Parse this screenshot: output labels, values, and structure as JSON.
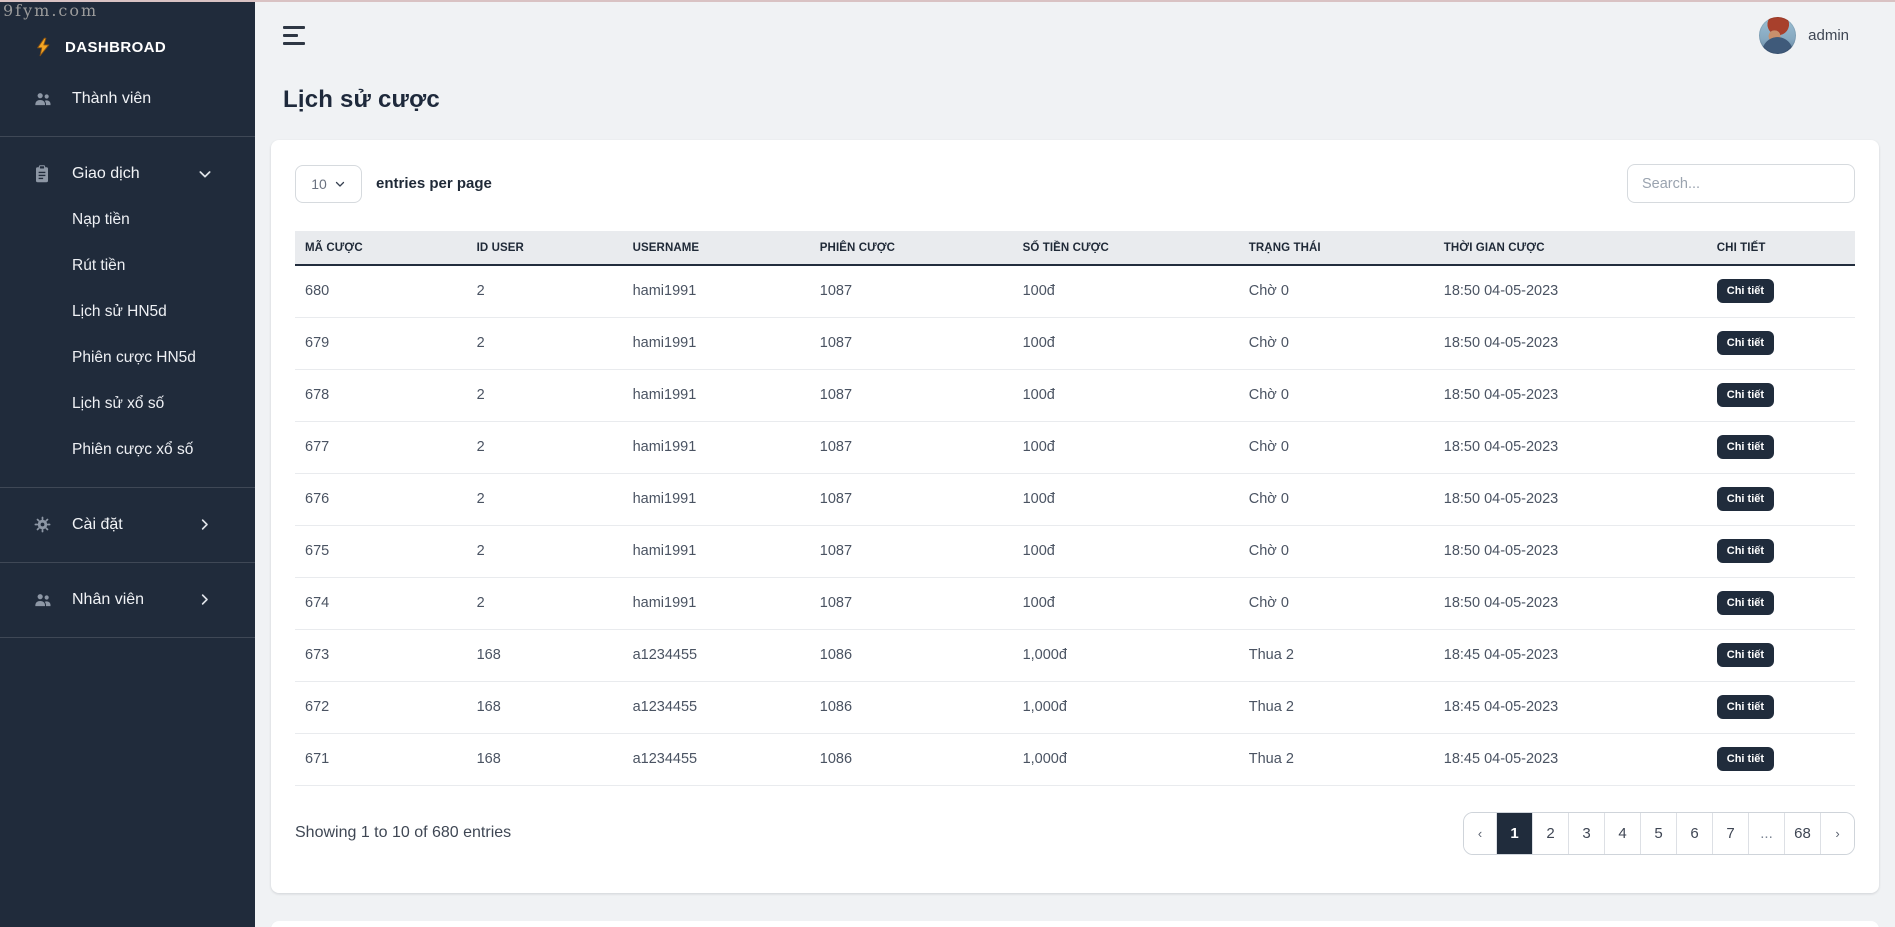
{
  "watermark": "9fym.com",
  "brand": {
    "label": "DASHBROAD"
  },
  "sidebar": {
    "items": [
      {
        "type": "link",
        "name": "thanh-vien",
        "icon": "users-icon",
        "label": "Thành viên"
      },
      {
        "type": "divider"
      },
      {
        "type": "link",
        "name": "giao-dich",
        "icon": "clipboard-icon",
        "label": "Giao dịch",
        "chevron": "down"
      },
      {
        "type": "sublink",
        "name": "nap-tien",
        "label": "Nạp tiền"
      },
      {
        "type": "sublink",
        "name": "rut-tien",
        "label": "Rút tiền"
      },
      {
        "type": "sublink",
        "name": "lich-su-hn5d",
        "label": "Lịch sử HN5d"
      },
      {
        "type": "sublink",
        "name": "phien-cuoc-hn5d",
        "label": "Phiên cược HN5d"
      },
      {
        "type": "sublink",
        "name": "lich-su-xo-so",
        "label": "Lịch sử xổ số"
      },
      {
        "type": "sublink",
        "name": "phien-cuoc-xo-so",
        "label": "Phiên cược xổ số"
      },
      {
        "type": "divider"
      },
      {
        "type": "link",
        "name": "cai-dat",
        "icon": "gear-icon",
        "label": "Cài đặt",
        "chevron": "right"
      },
      {
        "type": "divider"
      },
      {
        "type": "link",
        "name": "nhan-vien",
        "icon": "users-icon",
        "label": "Nhân viên",
        "chevron": "right"
      },
      {
        "type": "divider"
      }
    ]
  },
  "topbar": {
    "username": "admin"
  },
  "page": {
    "title": "Lịch sử cược"
  },
  "toolbar": {
    "page_size": "10",
    "entries_label": "entries per page",
    "search_placeholder": "Search..."
  },
  "table": {
    "columns": [
      "MÃ CƯỢC",
      "ID USER",
      "USERNAME",
      "PHIÊN CƯỢC",
      "SỐ TIỀN CƯỢC",
      "TRẠNG THÁI",
      "THỜI GIAN CƯỢC",
      "CHI TIẾT"
    ],
    "detail_button_label": "Chi tiết",
    "rows": [
      [
        "680",
        "2",
        "hami1991",
        "1087",
        "100đ",
        "Chờ 0",
        "18:50 04-05-2023"
      ],
      [
        "679",
        "2",
        "hami1991",
        "1087",
        "100đ",
        "Chờ 0",
        "18:50 04-05-2023"
      ],
      [
        "678",
        "2",
        "hami1991",
        "1087",
        "100đ",
        "Chờ 0",
        "18:50 04-05-2023"
      ],
      [
        "677",
        "2",
        "hami1991",
        "1087",
        "100đ",
        "Chờ 0",
        "18:50 04-05-2023"
      ],
      [
        "676",
        "2",
        "hami1991",
        "1087",
        "100đ",
        "Chờ 0",
        "18:50 04-05-2023"
      ],
      [
        "675",
        "2",
        "hami1991",
        "1087",
        "100đ",
        "Chờ 0",
        "18:50 04-05-2023"
      ],
      [
        "674",
        "2",
        "hami1991",
        "1087",
        "100đ",
        "Chờ 0",
        "18:50 04-05-2023"
      ],
      [
        "673",
        "168",
        "a1234455",
        "1086",
        "1,000đ",
        "Thua 2",
        "18:45 04-05-2023"
      ],
      [
        "672",
        "168",
        "a1234455",
        "1086",
        "1,000đ",
        "Thua 2",
        "18:45 04-05-2023"
      ],
      [
        "671",
        "168",
        "a1234455",
        "1086",
        "1,000đ",
        "Thua 2",
        "18:45 04-05-2023"
      ]
    ]
  },
  "footer": {
    "showing_text": "Showing 1 to 10 of 680 entries",
    "pagination": {
      "prev": "‹",
      "pages": [
        "1",
        "2",
        "3",
        "4",
        "5",
        "6",
        "7",
        "...",
        "68"
      ],
      "active": "1",
      "next": "›"
    }
  },
  "colors": {
    "sidebar_bg": "#202b3b",
    "accent_dark": "#202c3c",
    "bolt_orange": "#f5a623",
    "header_bg": "#e9ebee",
    "page_bg": "#f0f2f4"
  }
}
